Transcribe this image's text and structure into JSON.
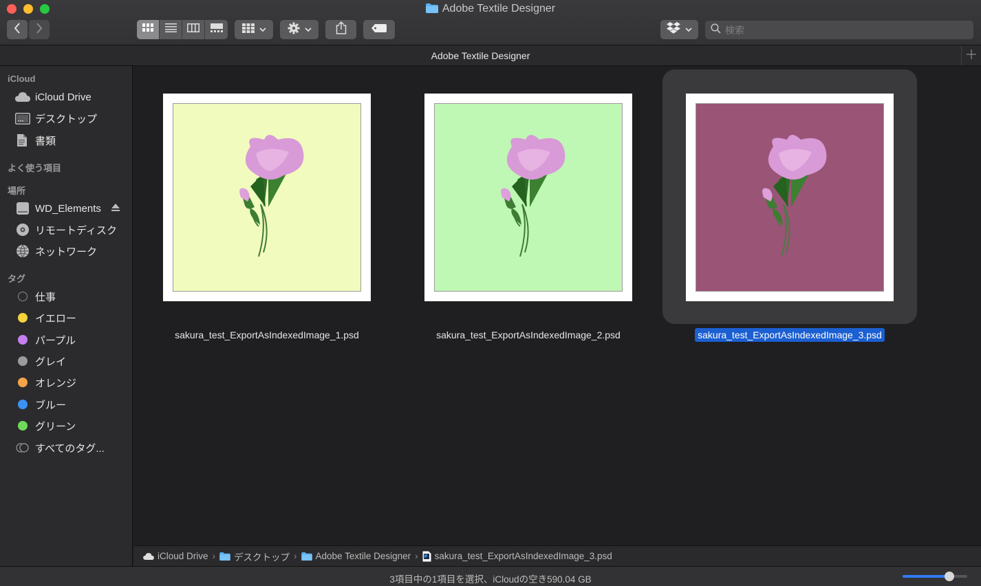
{
  "window": {
    "title": "Adobe Textile Designer",
    "traffic_lights": [
      "close",
      "minimize",
      "zoom"
    ]
  },
  "toolbar": {
    "nav": {
      "back_icon": "chevron-left-icon",
      "forward_icon": "chevron-right-icon"
    },
    "view_modes": [
      {
        "name": "icon-view",
        "active": true
      },
      {
        "name": "list-view",
        "active": false
      },
      {
        "name": "column-view",
        "active": false
      },
      {
        "name": "gallery-view",
        "active": false
      }
    ],
    "group_icon": "grid-icon",
    "action_icon": "gear-icon",
    "share_icon": "share-icon",
    "tag_icon": "tag-icon",
    "dropbox_icon": "dropbox-icon",
    "search": {
      "placeholder": "検索",
      "value": ""
    }
  },
  "tabbar": {
    "title": "Adobe Textile Designer"
  },
  "sidebar": {
    "sections": [
      {
        "title": "iCloud",
        "items": [
          {
            "label": "iCloud Drive",
            "icon": "cloud-icon"
          },
          {
            "label": "デスクトップ",
            "icon": "desktop-icon"
          },
          {
            "label": "書類",
            "icon": "document-icon"
          }
        ]
      },
      {
        "title": "よく使う項目",
        "items": []
      },
      {
        "title": "場所",
        "items": [
          {
            "label": "WD_Elements",
            "icon": "drive-icon",
            "eject": true
          },
          {
            "label": "リモートディスク",
            "icon": "disc-icon"
          },
          {
            "label": "ネットワーク",
            "icon": "network-icon"
          }
        ]
      },
      {
        "title": "タグ",
        "items": [
          {
            "label": "仕事",
            "color": ""
          },
          {
            "label": "イエロー",
            "color": "#f5d33c"
          },
          {
            "label": "パープル",
            "color": "#c77ef0"
          },
          {
            "label": "グレイ",
            "color": "#9b9b9d"
          },
          {
            "label": "オレンジ",
            "color": "#f6a34a"
          },
          {
            "label": "ブルー",
            "color": "#3d91f5"
          },
          {
            "label": "グリーン",
            "color": "#6fd85a"
          },
          {
            "label": "すべてのタグ...",
            "color": ""
          }
        ]
      }
    ]
  },
  "files": [
    {
      "name": "sakura_test_ExportAsIndexedImage_1.psd",
      "bg": "#f1fbbe",
      "selected": false
    },
    {
      "name": "sakura_test_ExportAsIndexedImage_2.psd",
      "bg": "#bff8b4",
      "selected": false
    },
    {
      "name": "sakura_test_ExportAsIndexedImage_3.psd",
      "bg": "#9a5475",
      "selected": true
    }
  ],
  "pathbar": {
    "crumbs": [
      {
        "label": "iCloud Drive",
        "icon": "cloud-icon"
      },
      {
        "label": "デスクトップ",
        "icon": "folder-icon"
      },
      {
        "label": "Adobe Textile Designer",
        "icon": "folder-icon"
      },
      {
        "label": "sakura_test_ExportAsIndexedImage_3.psd",
        "icon": "psd-file-icon"
      }
    ]
  },
  "status": {
    "text": "3項目中の1項目を選択、iCloudの空き590.04 GB",
    "icon_size_level": 0.72
  },
  "colors": {
    "accent": "#1b5fd1",
    "selection_bg": "#3a3a3c"
  }
}
